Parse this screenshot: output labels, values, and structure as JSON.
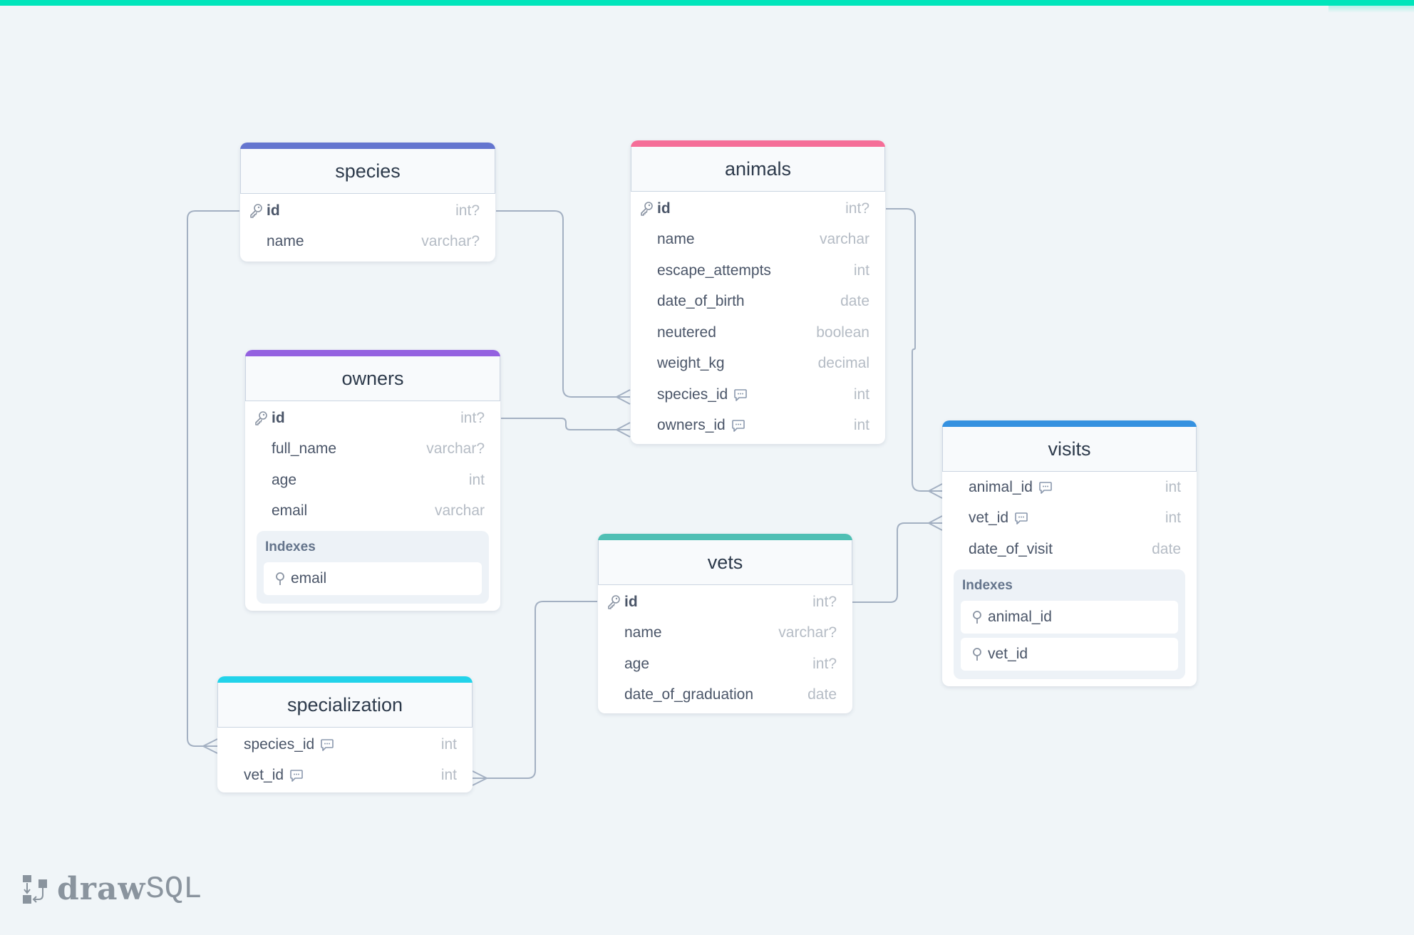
{
  "brand": {
    "word1": "draw",
    "word2": "SQL"
  },
  "colors": {
    "topbar": "#00e5bb",
    "species": "#6475cf",
    "animals": "#f56e98",
    "owners": "#9461e0",
    "specialization": "#22d3ea",
    "vets": "#4fbfb4",
    "visits": "#3591e0",
    "link": "#a3b0c2"
  },
  "tables": {
    "species": {
      "title": "species",
      "columns": [
        {
          "name": "id",
          "type": "int?",
          "pk": true
        },
        {
          "name": "name",
          "type": "varchar?"
        }
      ]
    },
    "animals": {
      "title": "animals",
      "columns": [
        {
          "name": "id",
          "type": "int?",
          "pk": true
        },
        {
          "name": "name",
          "type": "varchar"
        },
        {
          "name": "escape_attempts",
          "type": "int"
        },
        {
          "name": "date_of_birth",
          "type": "date"
        },
        {
          "name": "neutered",
          "type": "boolean"
        },
        {
          "name": "weight_kg",
          "type": "decimal"
        },
        {
          "name": "species_id",
          "type": "int",
          "comment": true
        },
        {
          "name": "owners_id",
          "type": "int",
          "comment": true
        }
      ]
    },
    "owners": {
      "title": "owners",
      "columns": [
        {
          "name": "id",
          "type": "int?",
          "pk": true
        },
        {
          "name": "full_name",
          "type": "varchar?"
        },
        {
          "name": "age",
          "type": "int"
        },
        {
          "name": "email",
          "type": "varchar"
        }
      ],
      "indexes_label": "Indexes",
      "indexes": [
        "email"
      ]
    },
    "specialization": {
      "title": "specialization",
      "columns": [
        {
          "name": "species_id",
          "type": "int",
          "comment": true
        },
        {
          "name": "vet_id",
          "type": "int",
          "comment": true
        }
      ]
    },
    "vets": {
      "title": "vets",
      "columns": [
        {
          "name": "id",
          "type": "int?",
          "pk": true
        },
        {
          "name": "name",
          "type": "varchar?"
        },
        {
          "name": "age",
          "type": "int?"
        },
        {
          "name": "date_of_graduation",
          "type": "date"
        }
      ]
    },
    "visits": {
      "title": "visits",
      "columns": [
        {
          "name": "animal_id",
          "type": "int",
          "comment": true
        },
        {
          "name": "vet_id",
          "type": "int",
          "comment": true
        },
        {
          "name": "date_of_visit",
          "type": "date"
        }
      ],
      "indexes_label": "Indexes",
      "indexes": [
        "animal_id",
        "vet_id"
      ]
    }
  },
  "relations": [
    {
      "from": "species.id",
      "to": "animals.species_id"
    },
    {
      "from": "owners.id",
      "to": "animals.owners_id"
    },
    {
      "from": "species.id",
      "to": "specialization.species_id"
    },
    {
      "from": "vets.id",
      "to": "specialization.vet_id"
    },
    {
      "from": "animals.id",
      "to": "visits.animal_id"
    },
    {
      "from": "vets.id",
      "to": "visits.vet_id"
    }
  ]
}
